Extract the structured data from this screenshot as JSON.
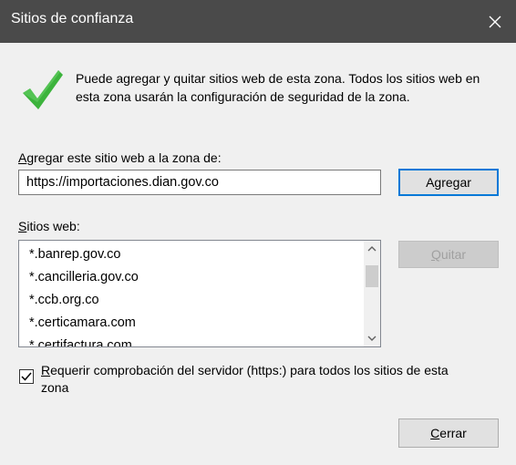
{
  "window": {
    "title": "Sitios de confianza",
    "close_icon": "close-icon"
  },
  "info": {
    "icon": "checkmark-icon",
    "text": "Puede agregar y quitar sitios web de esta zona. Todos los sitios web en esta zona usarán la configuración de seguridad de la zona."
  },
  "add_section": {
    "label_mnemonic": "A",
    "label_rest": "gregar este sitio web a la zona de:",
    "input_value": "https://importaciones.dian.gov.co",
    "add_button_pre": "Agre",
    "add_button_mnemonic": "g",
    "add_button_post": "ar"
  },
  "sites_section": {
    "label_mnemonic": "S",
    "label_rest": "itios web:",
    "items": [
      "*.banrep.gov.co",
      "*.cancilleria.gov.co",
      "*.ccb.org.co",
      "*.certicamara.com",
      "*.certifactura.com"
    ],
    "remove_button_mnemonic": "Q",
    "remove_button_rest": "uitar"
  },
  "https_check": {
    "checked": true,
    "label_mnemonic": "R",
    "label_rest": "equerir comprobación del servidor (https:) para todos los sitios de esta zona"
  },
  "footer": {
    "close_mnemonic": "C",
    "close_rest": "errar"
  },
  "colors": {
    "titlebar": "#4a4a4a",
    "dialog_bg": "#f0f0f0",
    "accent": "#0078d7",
    "check_green": "#3cb33c"
  }
}
